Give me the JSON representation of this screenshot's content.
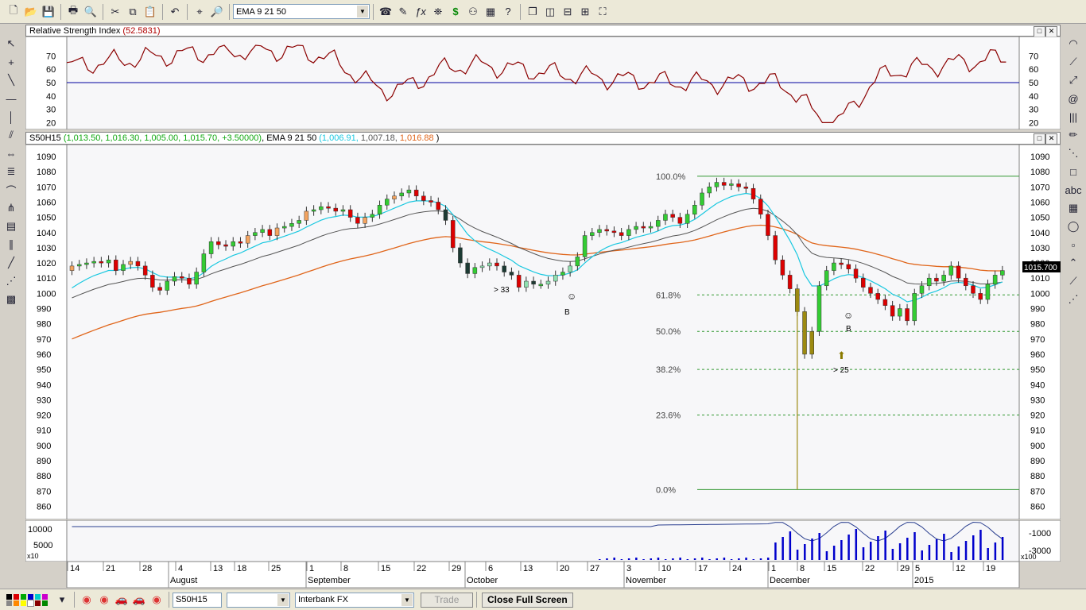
{
  "toolbar": {
    "indicator_combo": "EMA 9 21 50"
  },
  "rsi_panel": {
    "title": "Relative Strength Index",
    "value": "(52.5831)",
    "yticks": [
      "70",
      "60",
      "50",
      "40",
      "30",
      "20"
    ]
  },
  "price_panel": {
    "symbol": "S50H15",
    "ohlc": "(1,013.50, 1,016.30, 1,005.00, 1,015.70, +3.50000)",
    "ema_label": "EMA 9 21 50",
    "ema1": "(1,006.91,",
    "ema2": "1,007.18,",
    "ema3": "1,016.88",
    "close_paren": ")",
    "last_price": "1015.700",
    "yticks": [
      "1090",
      "1080",
      "1070",
      "1060",
      "1050",
      "1040",
      "1030",
      "1020",
      "1010",
      "1000",
      "990",
      "980",
      "970",
      "960",
      "950",
      "940",
      "930",
      "920",
      "910",
      "900",
      "890",
      "880",
      "870",
      "860"
    ],
    "fib": [
      "100.0%",
      "61.8%",
      "50.0%",
      "38.2%",
      "23.6%",
      "0.0%"
    ],
    "annotations": {
      "gt33": "> 33",
      "b1": "B",
      "b2": "B",
      "gt25": "> 25"
    }
  },
  "volume_panel": {
    "ytick": "10000",
    "ytick2": "5000",
    "mult": "x10",
    "right1": "-1000",
    "right2": "-3000",
    "right_mult": "x100"
  },
  "xaxis": {
    "days": [
      "14",
      "21",
      "28",
      "4",
      "13",
      "18",
      "25",
      "1",
      "8",
      "15",
      "22",
      "29",
      "6",
      "13",
      "20",
      "27",
      "3",
      "10",
      "17",
      "24",
      "1",
      "8",
      "15",
      "22",
      "29",
      "5",
      "12",
      "19"
    ],
    "months": [
      "August",
      "September",
      "October",
      "November",
      "December",
      "2015"
    ]
  },
  "bottom": {
    "symbol_field": "S50H15",
    "feed": "Interbank FX",
    "trade": "Trade",
    "close_full": "Close Full Screen"
  },
  "colors": {
    "up": "#33cc33",
    "down": "#dd0000",
    "ema_fast": "#19c8e0",
    "ema_mid": "#555555",
    "ema_slow": "#e0651a",
    "rsi": "#8b0000",
    "rsi_mid": "#0000a0",
    "fib": "#339933",
    "volume": "#0000cc"
  }
}
